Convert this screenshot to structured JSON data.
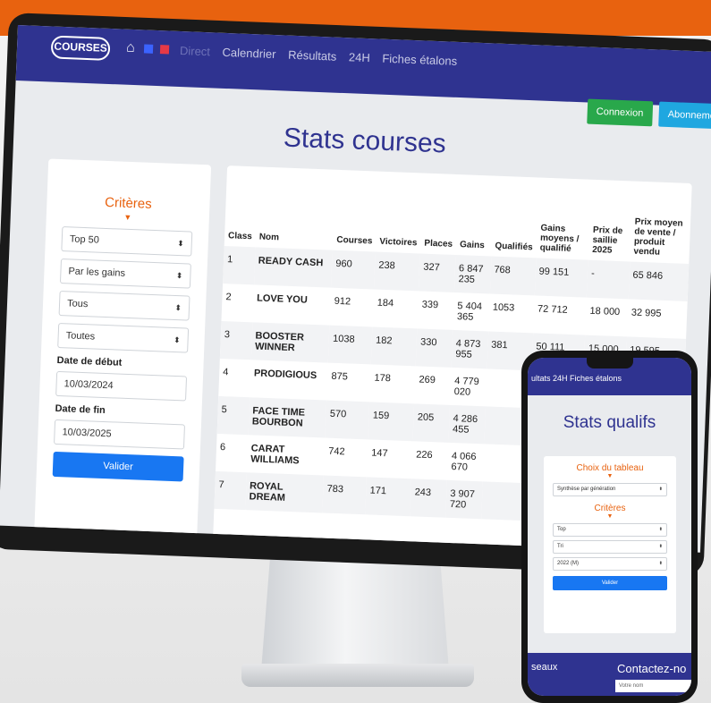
{
  "desktop": {
    "nav": {
      "logo": "COURSES",
      "links": [
        "Direct",
        "Calendrier",
        "Résultats",
        "24H",
        "Fiches étalons"
      ],
      "login_button": "Connexion",
      "subscribe_button": "Abonnement"
    },
    "page_title": "Stats courses",
    "criteria": {
      "title": "Critères",
      "selects": [
        "Top 50",
        "Par les gains",
        "Tous",
        "Toutes"
      ],
      "start_label": "Date de début",
      "start_value": "10/03/2024",
      "end_label": "Date de fin",
      "end_value": "10/03/2025",
      "submit": "Valider"
    },
    "table": {
      "columns": [
        "Class",
        "Nom",
        "Courses",
        "Victoires",
        "Places",
        "Gains",
        "Qualifiés",
        "Gains moyens / qualifié",
        "Prix de saillie 2025",
        "Prix moyen de vente / produit vendu"
      ],
      "rows": [
        [
          "1",
          "READY CASH",
          "960",
          "238",
          "327",
          "6 847 235",
          "768",
          "99 151",
          "-",
          "65 846"
        ],
        [
          "2",
          "LOVE YOU",
          "912",
          "184",
          "339",
          "5 404 365",
          "1053",
          "72 712",
          "18 000",
          "32 995"
        ],
        [
          "3",
          "BOOSTER WINNER",
          "1038",
          "182",
          "330",
          "4 873 955",
          "381",
          "50 111",
          "15 000",
          "19 595"
        ],
        [
          "4",
          "PRODIGIOUS",
          "875",
          "178",
          "269",
          "4 779 020",
          "",
          "",
          "",
          ""
        ],
        [
          "5",
          "FACE TIME BOURBON",
          "570",
          "159",
          "205",
          "4 286 455",
          "",
          "",
          "",
          ""
        ],
        [
          "6",
          "CARAT WILLIAMS",
          "742",
          "147",
          "226",
          "4 066 670",
          "",
          "",
          "",
          ""
        ],
        [
          "7",
          "ROYAL DREAM",
          "783",
          "171",
          "243",
          "3 907 720",
          "",
          "",
          "",
          ""
        ]
      ]
    }
  },
  "phone": {
    "nav_text": "ultats 24H Fiches étalons",
    "page_title": "Stats qualifs",
    "table_choice_title": "Choix du tableau",
    "table_choice_value": "Synthèse par génération",
    "criteria_title": "Critères",
    "selects": [
      "Top",
      "Tri",
      "2022 (M)"
    ],
    "submit": "Valider",
    "footer_left": "seaux",
    "footer_right": "Contactez-no",
    "footer_input_placeholder": "Votre nom"
  },
  "colors": {
    "brand_orange": "#e8620f",
    "navy": "#2f3390",
    "button_blue": "#1877f2",
    "green": "#29a84b",
    "cyan": "#1fa7e0"
  },
  "icons": [
    "home-icon",
    "select-caret-icon",
    "chevron-down-icon"
  ]
}
